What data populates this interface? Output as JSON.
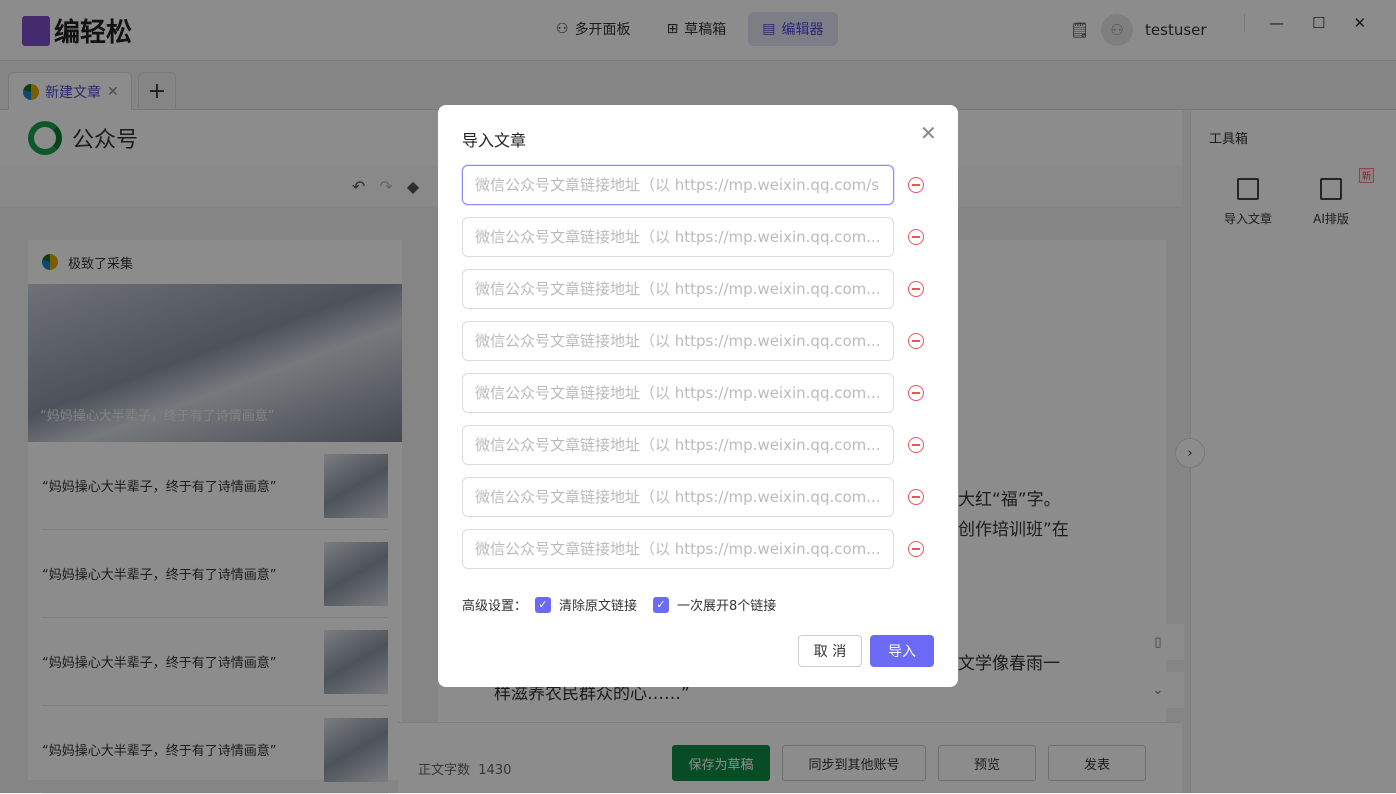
{
  "app": {
    "name": "编轻松"
  },
  "nav": [
    {
      "label": "多开面板",
      "icon": "user-icon"
    },
    {
      "label": "草稿箱",
      "icon": "grid-icon"
    },
    {
      "label": "编辑器",
      "icon": "editor-icon",
      "active": true
    }
  ],
  "user": {
    "name": "testuser"
  },
  "tabs": {
    "active": "新建文章",
    "add": "+"
  },
  "platform": {
    "name": "公众号"
  },
  "left_panel": {
    "source": "极致了采集",
    "cover_title": "“妈妈操心大半辈子，终于有了诗情画意”",
    "items": [
      "“妈妈操心大半辈子，终于有了诗情画意”",
      "“妈妈操心大半辈子，终于有了诗情画意”",
      "“妈妈操心大半辈子，终于有了诗情画意”",
      "“妈妈操心大半辈子，终于有了诗情画意”"
    ]
  },
  "editor": {
    "lines": [
      "大红“福”字。",
      "创作培训班”在",
      "文学像春雨一",
      "样滋养农民群众的心……”"
    ]
  },
  "toolbox": {
    "title": "工具箱",
    "tools": [
      {
        "label": "导入文章"
      },
      {
        "label": "AI排版",
        "badge": "新"
      }
    ]
  },
  "bottom": {
    "word_count_label": "正文字数",
    "word_count": "1430",
    "save_draft": "保存为草稿",
    "sync": "同步到其他账号",
    "preview": "预览",
    "publish": "发表"
  },
  "dialog": {
    "title": "导入文章",
    "first_placeholder": "微信公众号文章链接地址（以 https://mp.weixin.qq.com/s",
    "placeholder": "微信公众号文章链接地址（以 https://mp.weixin.qq.com...",
    "advanced_label": "高级设置：",
    "opt1": "清除原文链接",
    "opt2": "一次展开8个链接",
    "cancel": "取 消",
    "confirm": "导入"
  },
  "colors": {
    "accent": "#6a6af5",
    "green": "#0f8a45",
    "danger": "#e55555"
  }
}
